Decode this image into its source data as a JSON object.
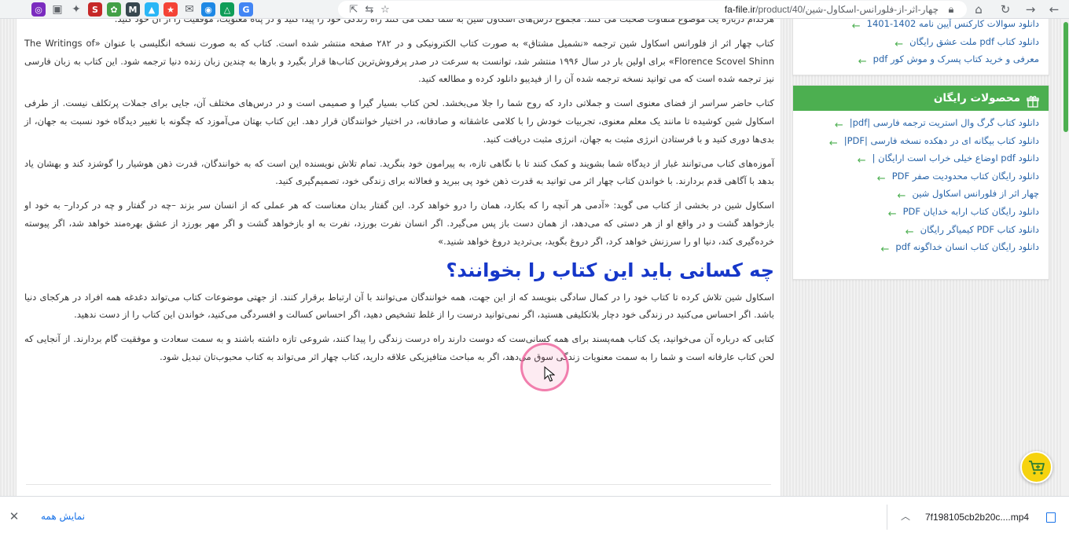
{
  "browser": {
    "url_host": "fa-file.ir",
    "url_path": "/product/40/چهار-اثر-از-فلورانس-اسکاول-شین",
    "extensions": [
      {
        "name": "extension-icon-1",
        "color": "#7b2cbf",
        "glyph": "◎"
      },
      {
        "name": "reading-list-icon",
        "color": "",
        "glyph": "▣"
      },
      {
        "name": "puzzle-icon",
        "color": "",
        "glyph": "✦"
      },
      {
        "name": "extension-icon-red",
        "color": "#c62828",
        "glyph": "S"
      },
      {
        "name": "extension-icon-green",
        "color": "#43a047",
        "glyph": "✿"
      },
      {
        "name": "extension-icon-m",
        "color": "#37474f",
        "glyph": "M"
      },
      {
        "name": "extension-icon-image",
        "color": "#29b6f6",
        "glyph": "▲"
      },
      {
        "name": "extension-icon-star",
        "color": "#f44336",
        "glyph": "★"
      },
      {
        "name": "mail-icon",
        "color": "",
        "glyph": "✉"
      },
      {
        "name": "chrome-icon",
        "color": "#1e88e5",
        "glyph": "◉"
      },
      {
        "name": "drive-icon",
        "color": "#0f9d58",
        "glyph": "△"
      },
      {
        "name": "translate-icon",
        "color": "#4285f4",
        "glyph": "G"
      }
    ]
  },
  "article": {
    "para0": "هرکدام درباره یک موضوع متفاوت صحبت می کنند. مجموع درس‌های اسکاول شین به شما کمک می کنند راه زندگی خود را پیدا کنید و در پناه معنویت، موفقیت را از آن خود کنید.",
    "para1": "کتاب چهار اثر از فلورانس اسکاول شین ترجمه «نشمیل مشتاق» به صورت کتاب الکترونیکی و در ۲۸۲ صفحه منتشر شده است. کتاب که به صورت نسخه انگلیسی با عنوان «The Writings of Florence Scovel Shinn» برای اولین بار در سال ۱۹۹۶ منتشر شد، توانست به سرعت در صدر پرفروش‌ترین کتاب‌ها قرار بگیرد و بارها به چندین زبان زنده دنیا ترجمه شود. این کتاب به زبان فارسی نیز ترجمه شده است که می توانید نسخه ترجمه شده آن را از فیدیبو دانلود کرده و مطالعه کنید.",
    "para2": "کتاب حاضر سراسر از فضای معنوی است و جملاتی دارد که روح شما را جلا می‌بخشد. لحن کتاب بسیار گیرا و صمیمی است و در درس‌های مختلف آن، جایی برای جملات پرتکلف نیست. از طرفی اسکاول شین کوشیده تا مانند یک معلم معنوی، تجربیات خودش را با کلامی عاشقانه و صادقانه، در اختیار خوانندگان قرار دهد. این کتاب بهتان می‌آموزد که چگونه با تغییر دیدگاه خود نسبت به جهان، از بدی‌ها دوری کنید و با فرستادن انرژی مثبت به جهان، انرژی مثبت دریافت کنید.",
    "para3": "آموزه‌های کتاب می‌توانند غبار از دیدگاه شما بشویند و کمک کنند تا با نگاهی تازه، به پیرامون خود بنگرید. تمام تلاش نویسنده این است که به خوانندگان، قدرت ذهن هوشیار را گوشزد کند و بهشان یاد بدهد با آگاهی قدم بردارند. با خواندن کتاب چهار اثر می توانید به قدرت ذهن خود پی ببرید و فعالانه برای زندگی خود، تصمیم‌گیری کنید.",
    "para4": "اسکاول شین در بخشی از کتاب می گوید: «آدمی هر آنچه را که بکارد، همان را درو خواهد کرد. این گفتار بدان معناست که هر عملی که از انسان سر بزند –چه در گفتار و چه در کردار– به خود او بازخواهد گشت و در واقع او از هر دستی که می‌دهد، از همان دست باز پس می‌گیرد. اگر انسان نفرت بورزد، نفرت به او بازخواهد گشت و اگر مهر بورزد از عشق بهره‌مند خواهد شد، اگر پیوسته خرده‌گیری کند، دنیا او را سرزنش خواهد کرد، اگر دروغ بگوید، بی‌تردید دروغ خواهد شنید.»",
    "heading": "چه کسانی باید این کتاب را بخوانند؟",
    "para5": "اسکاول شین تلاش کرده تا کتاب خود را در کمال سادگی بنویسد که از این جهت، همه خوانندگان می‌توانند با آن ارتباط برقرار کنند. از جهتی موضوعات کتاب می‌تواند دغدغه همه افراد در هرکجای دنیا باشد. اگر احساس می‌کنید در زندگی خود دچار بلاتکلیفی هستید، اگر نمی‌توانید درست را از غلط تشخیص دهید، اگر احساس کسالت و افسردگی می‌کنید، خواندن این کتاب را از دست ندهید.",
    "para6": "کتابی که درباره آن می‌خوانید، یک کتاب همه‌پسند برای همه کسانی‌ست که دوست دارند راه درست زندگی را پیدا کنند، شروعی تازه داشته باشند و به سمت سعادت و موفقیت گام بردارند. از آنجایی که لحن کتاب عارفانه است و شما را به سمت معنویات زندگی سوق می‌دهد، اگر به مباحث متافیزیکی علاقه دارید، کتاب چهار اثر می‌تواند به کتاب محبوب‌تان تبدیل شود."
  },
  "sidebar": {
    "top_links": [
      "دانلود سوالات کارکنس آیین نامه 1402-1401",
      "دانلود کتاب pdf ملت عشق رایگان",
      "معرفی و خرید کتاب پسرک و موش کور pdf"
    ],
    "free_title": "محصولات رایگان",
    "free_links": [
      "دانلود کتاب گرگ وال استریت ترجمه فارسی |pdf|",
      "دانلود کتاب بیگانه ای در دهکده نسخه فارسی |PDF|",
      "دانلود pdf اوضاع خیلی خراب است ارایگان |",
      "دانلود رایگان کتاب محدودیت صفر PDF",
      "چهار اثر از فلورانس اسکاول شین",
      "دانلود رایگان کتاب ارابه خدایان PDF",
      "دانلود کتاب PDF کیمیاگر رایگان",
      "دانلود رایگان کتاب انسان خداگونه pdf"
    ]
  },
  "download_shelf": {
    "show_all": "نمایش همه",
    "file_name": "7f198105cb2b20c....mp4"
  },
  "colors": {
    "accent_green": "#4caf50",
    "heading_blue": "#1637c9",
    "link_blue": "#2864a8"
  }
}
